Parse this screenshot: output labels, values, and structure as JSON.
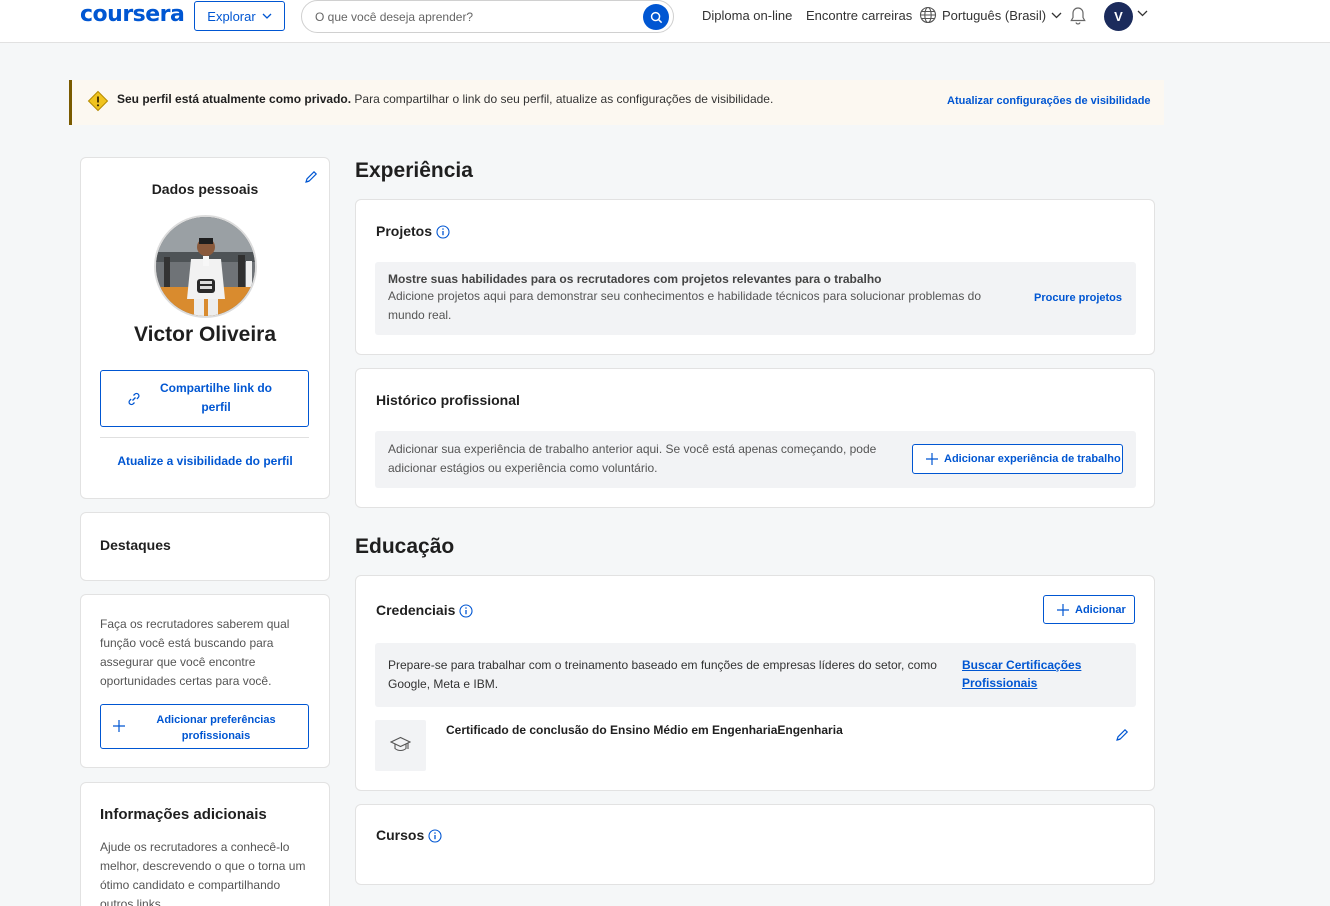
{
  "header": {
    "logo": "coursera",
    "explore_label": "Explorar",
    "search_placeholder": "O que você deseja aprender?",
    "nav": [
      "Diploma on-line",
      "Encontre carreiras"
    ],
    "language": "Português (Brasil)",
    "avatar_initial": "V"
  },
  "alert": {
    "bold": "Seu perfil está atualmente como privado.",
    "text": " Para compartilhar o link do seu perfil, atualize as configurações de visibilidade.",
    "link": "Atualizar configurações de visibilidade"
  },
  "profile": {
    "title": "Dados pessoais",
    "name": "Victor Oliveira",
    "share_button": "Compartilhe link do perfil",
    "visibility_link": "Atualize a visibilidade do perfil"
  },
  "highlights": {
    "title": "Destaques"
  },
  "preferences": {
    "text": "Faça os recrutadores saberem qual função você está buscando para assegurar que você encontre oportunidades certas para você.",
    "button": "Adicionar preferências profissionais"
  },
  "additional": {
    "title": "Informações adicionais",
    "text": "Ajude os recrutadores a conhecê-lo melhor, descrevendo o que o torna um ótimo candidato e compartilhando outros links."
  },
  "experience": {
    "heading": "Experiência",
    "projects": {
      "title": "Projetos",
      "box_title": "Mostre suas habilidades para os recrutadores com projetos relevantes para o trabalho",
      "box_text": "Adicione projetos aqui para demonstrar seu conhecimentos e habilidade técnicos para solucionar problemas do mundo real.",
      "link": "Procure projetos"
    },
    "history": {
      "title": "Histórico profissional",
      "text": "Adicionar sua experiência de trabalho anterior aqui. Se você está apenas começando, pode adicionar estágios ou experiência como voluntário.",
      "button": "Adicionar experiência de trabalho"
    }
  },
  "education": {
    "heading": "Educação",
    "credentials": {
      "title": "Credenciais",
      "add_button": "Adicionar",
      "promo_text": "Prepare-se para trabalhar com o treinamento baseado em funções de empresas líderes do setor, como Google, Meta e IBM.",
      "promo_link": "Buscar Certificações Profissionais",
      "item": "Certificado de conclusão do Ensino Médio em EngenhariaEngenharia"
    },
    "courses": {
      "title": "Cursos"
    }
  },
  "colors": {
    "accent": "#0056d2",
    "alert_bg": "#fcf8f1",
    "alert_border": "#7a5b00"
  }
}
